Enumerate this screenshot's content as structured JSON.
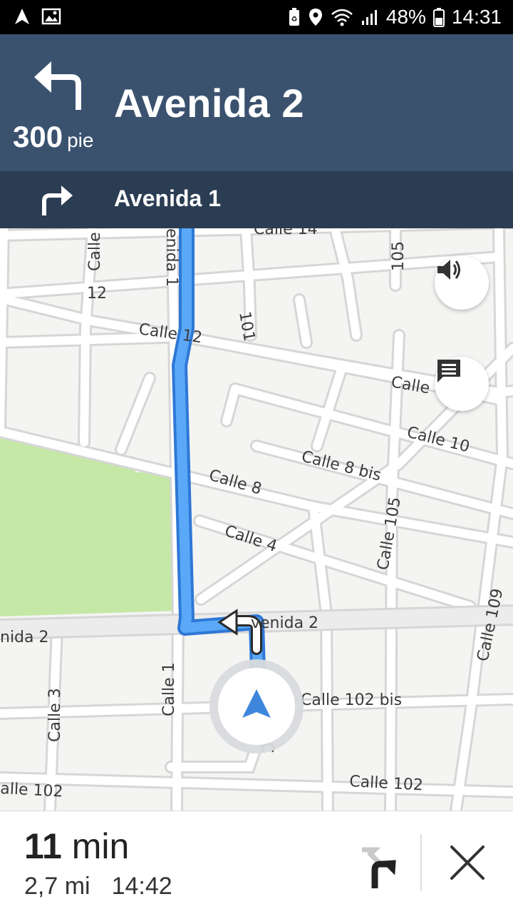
{
  "status_bar": {
    "battery": "48%",
    "time": "14:31",
    "icons": [
      "navigation-icon",
      "image-icon",
      "battery-saver-icon",
      "location-icon",
      "wifi-icon",
      "signal-icon",
      "battery-icon"
    ]
  },
  "navigation": {
    "maneuver_icon": "turn-left-icon",
    "distance_value": "300",
    "distance_unit": "pie",
    "current_street": "Avenida 2",
    "next_maneuver_icon": "turn-right-icon",
    "next_street": "Avenida 1"
  },
  "map": {
    "labels": {
      "calle_top": "Calle",
      "calle_14": "Calle 14",
      "label_105_top": "105",
      "label_12": "12",
      "avenida_1_vert": "enida 1",
      "label_101": "101",
      "calle_12": "Calle 12",
      "calle_right": "Calle",
      "calle_10": "Calle 10",
      "calle_8bis": "Calle 8 bis",
      "calle_8": "Calle 8",
      "calle_105": "Calle 105",
      "calle_4": "Calle 4",
      "calle_109": "Calle 109",
      "avenida_2_left": "nida 2",
      "avenida_2_right": "venida 2",
      "calle_3": "Calle 3",
      "calle_1": "Calle 1",
      "calle_102bis": "Calle 102 bis",
      "calle_102_left": "alle 102",
      "calle_102_right": "Calle 102",
      "c_fragment": "C"
    },
    "colors": {
      "route": "#4a9af5",
      "park": "#c5e8a6",
      "road": "#ffffff",
      "background": "#f4f4f2"
    },
    "buttons": [
      "volume-icon",
      "report-icon"
    ]
  },
  "trip": {
    "duration_value": "11",
    "duration_unit": "min",
    "distance": "2,7 mi",
    "arrival": "14:42",
    "route_overview_icon": "route-overview-icon",
    "close_icon": "close-icon"
  },
  "colors": {
    "header": "#3b526f",
    "subheader": "#2b3d52",
    "route": "#4a9af5"
  }
}
